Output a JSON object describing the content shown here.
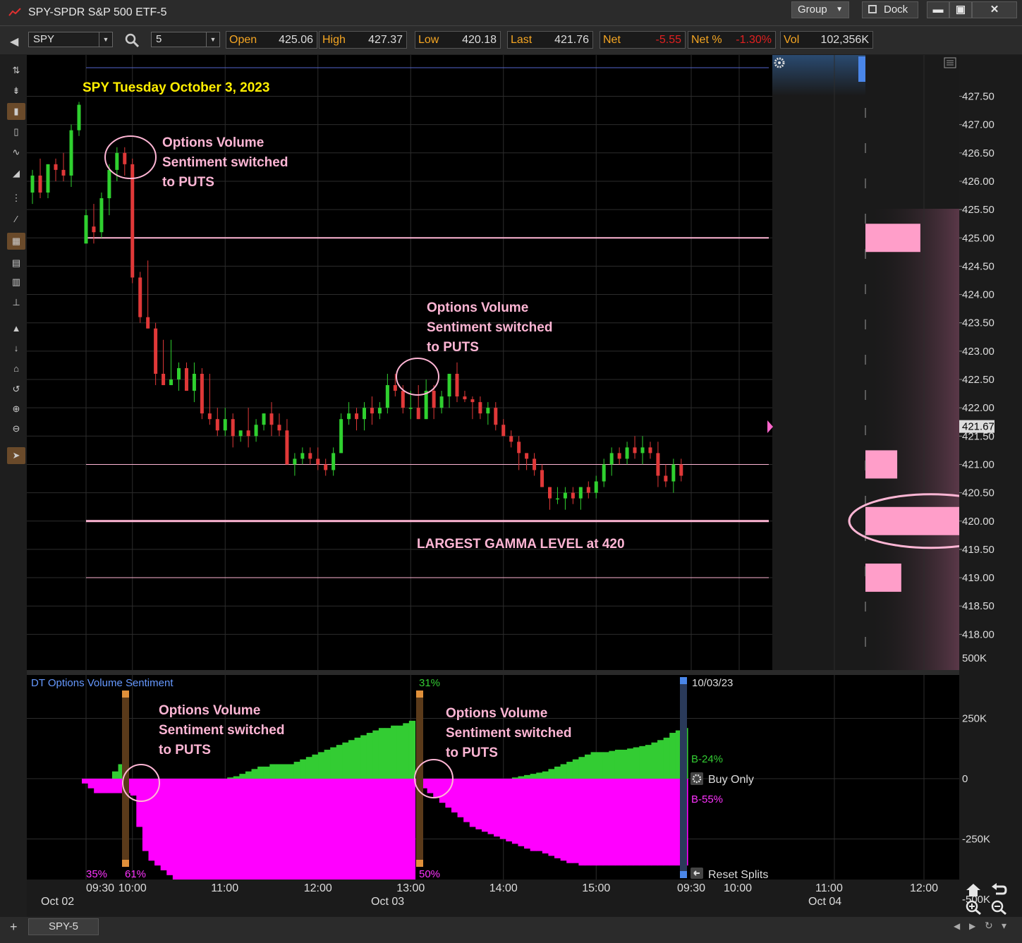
{
  "window": {
    "title": "SPY-SPDR S&P 500 ETF-5",
    "group_label": "Group",
    "dock_label": "Dock",
    "minimize_glyph": "▬",
    "maximize_glyph": "▣",
    "close_glyph": "✕"
  },
  "symbol_bar": {
    "symbol": "SPY",
    "interval": "5",
    "quotes": [
      {
        "label": "Open",
        "value": "425.06",
        "neg": false
      },
      {
        "label": "High",
        "value": "427.37",
        "neg": false
      },
      {
        "label": "Low",
        "value": "420.18",
        "neg": false
      },
      {
        "label": "Last",
        "value": "421.76",
        "neg": false
      },
      {
        "label": "Net",
        "value": "-5.55",
        "neg": true
      },
      {
        "label": "Net %",
        "value": "-1.30%",
        "neg": true
      },
      {
        "label": "Vol",
        "value": "102,356K",
        "neg": false
      }
    ]
  },
  "toolbar_icons": [
    "crosshair-icon",
    "cursor-data-icon",
    "candlestick-icon",
    "bar-chart-icon",
    "line-chart-icon",
    "area-chart-icon",
    "indicators-icon",
    "drawing-tool-icon",
    "grid-icon",
    "table-icon",
    "grid-small-icon",
    "horizontal-line-icon",
    "scroll-up-icon",
    "scroll-small-icon",
    "home-icon",
    "undo-icon",
    "zoom-in-icon",
    "zoom-out-icon",
    "select-arrow-icon"
  ],
  "chart_data": {
    "type": "candlestick",
    "title": "SPY Tuesday October 3, 2023",
    "interval_minutes": 5,
    "ylim": [
      417.6,
      427.9
    ],
    "yticks": [
      "427.50",
      "427.00",
      "426.50",
      "426.00",
      "425.50",
      "425.00",
      "424.50",
      "424.00",
      "423.50",
      "423.00",
      "422.50",
      "422.00",
      "421.50",
      "421.00",
      "420.50",
      "420.00",
      "419.50",
      "419.00",
      "418.50",
      "418.00"
    ],
    "last_price_label": "421.67",
    "x_start": "Oct 02 15:30",
    "x_end": "Oct 04 12:00",
    "time_labels": [
      "09:30",
      "10:00",
      "11:00",
      "12:00",
      "13:00",
      "14:00",
      "15:00",
      "09:30",
      "10:00",
      "11:00",
      "12:00"
    ],
    "date_labels": [
      "Oct 02",
      "Oct 03",
      "Oct 04"
    ],
    "candles_prev_day": [
      {
        "t": "Oct 02 15:30",
        "o": 425.8,
        "h": 426.2,
        "l": 425.6,
        "c": 426.1
      },
      {
        "t": "Oct 02 15:35",
        "o": 426.1,
        "h": 426.4,
        "l": 425.7,
        "c": 425.8
      },
      {
        "t": "Oct 02 15:40",
        "o": 425.8,
        "h": 426.3,
        "l": 425.7,
        "c": 426.3
      },
      {
        "t": "Oct 02 15:45",
        "o": 426.3,
        "h": 426.4,
        "l": 426.0,
        "c": 426.2
      },
      {
        "t": "Oct 02 15:50",
        "o": 426.2,
        "h": 426.5,
        "l": 426.0,
        "c": 426.1
      },
      {
        "t": "Oct 02 15:55",
        "o": 426.1,
        "h": 427.0,
        "l": 425.9,
        "c": 426.9
      },
      {
        "t": "Oct 02 16:00",
        "o": 426.9,
        "h": 427.4,
        "l": 426.8,
        "c": 427.35
      }
    ],
    "candles": [
      {
        "t": "09:30",
        "o": 424.9,
        "h": 425.5,
        "l": 424.9,
        "c": 425.4
      },
      {
        "t": "09:35",
        "o": 425.2,
        "h": 425.6,
        "l": 424.9,
        "c": 425.1
      },
      {
        "t": "09:40",
        "o": 425.1,
        "h": 425.8,
        "l": 425.0,
        "c": 425.7
      },
      {
        "t": "09:45",
        "o": 425.7,
        "h": 426.3,
        "l": 425.4,
        "c": 426.2
      },
      {
        "t": "09:50",
        "o": 426.2,
        "h": 426.6,
        "l": 426.0,
        "c": 426.5
      },
      {
        "t": "09:55",
        "o": 426.5,
        "h": 426.6,
        "l": 426.1,
        "c": 426.3
      },
      {
        "t": "10:00",
        "o": 426.3,
        "h": 426.4,
        "l": 424.2,
        "c": 424.3
      },
      {
        "t": "10:05",
        "o": 424.3,
        "h": 424.4,
        "l": 423.5,
        "c": 423.6
      },
      {
        "t": "10:10",
        "o": 423.6,
        "h": 424.6,
        "l": 423.4,
        "c": 423.4
      },
      {
        "t": "10:15",
        "o": 423.4,
        "h": 423.5,
        "l": 422.4,
        "c": 422.6
      },
      {
        "t": "10:20",
        "o": 422.6,
        "h": 423.2,
        "l": 422.4,
        "c": 422.4
      },
      {
        "t": "10:25",
        "o": 422.4,
        "h": 423.2,
        "l": 422.4,
        "c": 422.5
      },
      {
        "t": "10:30",
        "o": 422.5,
        "h": 422.8,
        "l": 422.3,
        "c": 422.7
      },
      {
        "t": "10:35",
        "o": 422.7,
        "h": 422.8,
        "l": 422.3,
        "c": 422.3
      },
      {
        "t": "10:40",
        "o": 422.3,
        "h": 422.8,
        "l": 422.1,
        "c": 422.6
      },
      {
        "t": "10:45",
        "o": 422.6,
        "h": 422.7,
        "l": 421.8,
        "c": 421.9
      },
      {
        "t": "10:50",
        "o": 421.9,
        "h": 422.6,
        "l": 421.7,
        "c": 421.8
      },
      {
        "t": "10:55",
        "o": 421.8,
        "h": 422.0,
        "l": 421.5,
        "c": 421.6
      },
      {
        "t": "11:00",
        "o": 421.6,
        "h": 422.0,
        "l": 421.5,
        "c": 421.8
      },
      {
        "t": "11:05",
        "o": 421.8,
        "h": 421.9,
        "l": 421.3,
        "c": 421.5
      },
      {
        "t": "11:10",
        "o": 421.5,
        "h": 421.6,
        "l": 421.4,
        "c": 421.6
      },
      {
        "t": "11:15",
        "o": 421.6,
        "h": 422.0,
        "l": 421.3,
        "c": 421.5
      },
      {
        "t": "11:20",
        "o": 421.5,
        "h": 421.8,
        "l": 421.4,
        "c": 421.7
      },
      {
        "t": "11:25",
        "o": 421.7,
        "h": 421.9,
        "l": 421.6,
        "c": 421.9
      },
      {
        "t": "11:30",
        "o": 421.9,
        "h": 422.1,
        "l": 421.5,
        "c": 421.7
      },
      {
        "t": "11:35",
        "o": 421.7,
        "h": 421.9,
        "l": 421.5,
        "c": 421.6
      },
      {
        "t": "11:40",
        "o": 421.6,
        "h": 421.8,
        "l": 421.0,
        "c": 421.0
      },
      {
        "t": "11:45",
        "o": 421.0,
        "h": 421.2,
        "l": 420.8,
        "c": 421.1
      },
      {
        "t": "11:50",
        "o": 421.1,
        "h": 421.3,
        "l": 421.0,
        "c": 421.2
      },
      {
        "t": "11:55",
        "o": 421.2,
        "h": 421.3,
        "l": 421.0,
        "c": 421.1
      },
      {
        "t": "12:00",
        "o": 421.1,
        "h": 421.3,
        "l": 420.9,
        "c": 421.0
      },
      {
        "t": "12:05",
        "o": 421.0,
        "h": 421.1,
        "l": 420.8,
        "c": 420.9
      },
      {
        "t": "12:10",
        "o": 420.9,
        "h": 421.3,
        "l": 420.8,
        "c": 421.2
      },
      {
        "t": "12:15",
        "o": 421.2,
        "h": 421.9,
        "l": 421.2,
        "c": 421.8
      },
      {
        "t": "12:20",
        "o": 421.8,
        "h": 422.1,
        "l": 421.7,
        "c": 421.9
      },
      {
        "t": "12:25",
        "o": 421.9,
        "h": 422.0,
        "l": 421.6,
        "c": 421.8
      },
      {
        "t": "12:30",
        "o": 421.8,
        "h": 422.1,
        "l": 421.6,
        "c": 422.0
      },
      {
        "t": "12:35",
        "o": 422.0,
        "h": 422.2,
        "l": 421.7,
        "c": 421.9
      },
      {
        "t": "12:40",
        "o": 421.9,
        "h": 422.1,
        "l": 421.8,
        "c": 422.0
      },
      {
        "t": "12:45",
        "o": 422.0,
        "h": 422.6,
        "l": 421.9,
        "c": 422.4
      },
      {
        "t": "12:50",
        "o": 422.4,
        "h": 422.6,
        "l": 422.2,
        "c": 422.3
      },
      {
        "t": "12:55",
        "o": 422.3,
        "h": 422.4,
        "l": 421.9,
        "c": 422.0
      },
      {
        "t": "13:00",
        "o": 422.0,
        "h": 422.3,
        "l": 421.8,
        "c": 422.0
      },
      {
        "t": "13:05",
        "o": 422.0,
        "h": 422.4,
        "l": 421.8,
        "c": 421.8
      },
      {
        "t": "13:10",
        "o": 421.8,
        "h": 422.5,
        "l": 421.8,
        "c": 422.3
      },
      {
        "t": "13:15",
        "o": 422.3,
        "h": 422.4,
        "l": 421.8,
        "c": 422.0
      },
      {
        "t": "13:20",
        "o": 422.0,
        "h": 422.3,
        "l": 421.9,
        "c": 422.2
      },
      {
        "t": "13:25",
        "o": 422.2,
        "h": 422.6,
        "l": 422.0,
        "c": 422.6
      },
      {
        "t": "13:30",
        "o": 422.6,
        "h": 422.8,
        "l": 422.1,
        "c": 422.2
      },
      {
        "t": "13:35",
        "o": 422.2,
        "h": 422.3,
        "l": 422.1,
        "c": 422.15
      },
      {
        "t": "13:40",
        "o": 422.15,
        "h": 422.2,
        "l": 421.8,
        "c": 422.1
      },
      {
        "t": "13:45",
        "o": 422.1,
        "h": 422.2,
        "l": 421.8,
        "c": 421.9
      },
      {
        "t": "13:50",
        "o": 421.9,
        "h": 422.1,
        "l": 421.7,
        "c": 422.0
      },
      {
        "t": "13:55",
        "o": 422.0,
        "h": 422.1,
        "l": 421.6,
        "c": 421.7
      },
      {
        "t": "14:00",
        "o": 421.7,
        "h": 421.8,
        "l": 421.5,
        "c": 421.5
      },
      {
        "t": "14:05",
        "o": 421.5,
        "h": 421.6,
        "l": 421.3,
        "c": 421.4
      },
      {
        "t": "14:10",
        "o": 421.4,
        "h": 421.5,
        "l": 420.9,
        "c": 421.2
      },
      {
        "t": "14:15",
        "o": 421.2,
        "h": 421.2,
        "l": 420.9,
        "c": 421.1
      },
      {
        "t": "14:20",
        "o": 421.1,
        "h": 421.2,
        "l": 420.8,
        "c": 420.9
      },
      {
        "t": "14:25",
        "o": 420.9,
        "h": 421.0,
        "l": 420.6,
        "c": 420.6
      },
      {
        "t": "14:30",
        "o": 420.6,
        "h": 420.6,
        "l": 420.2,
        "c": 420.4
      },
      {
        "t": "14:35",
        "o": 420.4,
        "h": 420.6,
        "l": 420.3,
        "c": 420.4
      },
      {
        "t": "14:40",
        "o": 420.4,
        "h": 420.6,
        "l": 420.2,
        "c": 420.5
      },
      {
        "t": "14:45",
        "o": 420.5,
        "h": 420.6,
        "l": 420.3,
        "c": 420.4
      },
      {
        "t": "14:50",
        "o": 420.4,
        "h": 420.6,
        "l": 420.2,
        "c": 420.6
      },
      {
        "t": "14:55",
        "o": 420.6,
        "h": 420.7,
        "l": 420.4,
        "c": 420.5
      },
      {
        "t": "15:00",
        "o": 420.5,
        "h": 420.8,
        "l": 420.4,
        "c": 420.7
      },
      {
        "t": "15:05",
        "o": 420.7,
        "h": 421.1,
        "l": 420.6,
        "c": 421.0
      },
      {
        "t": "15:10",
        "o": 421.0,
        "h": 421.3,
        "l": 420.8,
        "c": 421.2
      },
      {
        "t": "15:15",
        "o": 421.2,
        "h": 421.3,
        "l": 421.0,
        "c": 421.1
      },
      {
        "t": "15:20",
        "o": 421.1,
        "h": 421.4,
        "l": 421.0,
        "c": 421.3
      },
      {
        "t": "15:25",
        "o": 421.3,
        "h": 421.5,
        "l": 421.1,
        "c": 421.2
      },
      {
        "t": "15:30",
        "o": 421.2,
        "h": 421.5,
        "l": 421.0,
        "c": 421.3
      },
      {
        "t": "15:35",
        "o": 421.3,
        "h": 421.4,
        "l": 421.1,
        "c": 421.2
      },
      {
        "t": "15:40",
        "o": 421.2,
        "h": 421.4,
        "l": 420.6,
        "c": 420.8
      },
      {
        "t": "15:45",
        "o": 420.8,
        "h": 421.0,
        "l": 420.6,
        "c": 420.7
      },
      {
        "t": "15:50",
        "o": 420.7,
        "h": 421.1,
        "l": 420.5,
        "c": 421.0
      },
      {
        "t": "15:55",
        "o": 421.0,
        "h": 421.1,
        "l": 420.7,
        "c": 420.8
      }
    ],
    "gamma_lines": [
      425.0,
      421.0,
      420.0,
      419.0
    ],
    "gamma_bars": [
      {
        "price": 425.0,
        "strength": 0.95
      },
      {
        "price": 421.0,
        "strength": 0.55
      },
      {
        "price": 420.0,
        "strength": 1.65
      },
      {
        "price": 419.0,
        "strength": 0.62
      }
    ],
    "annotations": [
      {
        "id": "ann1",
        "lines": [
          "Options Volume",
          "Sentiment switched",
          "to PUTS"
        ]
      },
      {
        "id": "ann2",
        "lines": [
          "Options Volume",
          "Sentiment switched",
          "to PUTS"
        ]
      },
      {
        "id": "gamma",
        "lines": [
          "LARGEST GAMMA LEVEL at 420"
        ]
      }
    ]
  },
  "indicator": {
    "title": "DT Options Volume Sentiment",
    "date_label": "10/03/23",
    "yticks": [
      "500K",
      "250K",
      "0",
      "-250K",
      "-500K"
    ],
    "ylim": [
      -750,
      750
    ],
    "calls_label": "B-24%",
    "puts_label": "B-55%",
    "buy_only_label": "Buy Only",
    "reset_label": "Reset Splits",
    "pct_labels": [
      {
        "text": "35%",
        "color": "#ff33ff"
      },
      {
        "text": "61%",
        "color": "#ff33ff"
      },
      {
        "text": "31%",
        "color": "#33cc33"
      },
      {
        "text": "50%",
        "color": "#ff33ff"
      }
    ],
    "annotations": [
      {
        "lines": [
          "Options Volume",
          "Sentiment switched",
          "to PUTS"
        ]
      },
      {
        "lines": [
          "Options Volume",
          "Sentiment switched",
          "to PUTS"
        ]
      }
    ],
    "calls_series_k": [
      0,
      0,
      0,
      0,
      0,
      30,
      60,
      0,
      0,
      0,
      0,
      0,
      0,
      0,
      0,
      0,
      0,
      0,
      0,
      0,
      0,
      0,
      0,
      0,
      5,
      10,
      20,
      30,
      40,
      50,
      50,
      60,
      60,
      60,
      60,
      70,
      80,
      90,
      100,
      110,
      120,
      130,
      140,
      150,
      160,
      170,
      180,
      190,
      200,
      210,
      210,
      220,
      220,
      230,
      240,
      0,
      0,
      0,
      0,
      0,
      0,
      0,
      0,
      0,
      0,
      0,
      0,
      0,
      0,
      0,
      0,
      5,
      10,
      15,
      20,
      25,
      30,
      40,
      50,
      60,
      70,
      80,
      90,
      100,
      110,
      110,
      110,
      115,
      120,
      120,
      125,
      130,
      135,
      140,
      150,
      160,
      170,
      190,
      200,
      210
    ],
    "puts_series_k": [
      -20,
      -40,
      -60,
      -60,
      -60,
      -60,
      -60,
      -60,
      -70,
      -200,
      -300,
      -340,
      -360,
      -380,
      -400,
      -420,
      -440,
      -460,
      -480,
      -500,
      -520,
      -540,
      -560,
      -580,
      -600,
      -620,
      -640,
      -650,
      -660,
      -680,
      -700,
      -710,
      -720,
      -730,
      -740,
      -750,
      -750,
      -750,
      -750,
      -750,
      -750,
      -750,
      -750,
      -750,
      -750,
      -750,
      -750,
      -750,
      -750,
      -750,
      -750,
      -750,
      -750,
      -750,
      -750,
      -20,
      -40,
      -60,
      -80,
      -100,
      -120,
      -140,
      -160,
      -180,
      -200,
      -210,
      -220,
      -230,
      -240,
      -250,
      -260,
      -270,
      -280,
      -290,
      -300,
      -300,
      -310,
      -320,
      -330,
      -340,
      -350,
      -350,
      -360,
      -360,
      -360,
      -360,
      -360,
      -360,
      -360,
      -360,
      -360,
      -360,
      -360,
      -360,
      -360,
      -360,
      -360,
      -360,
      -360,
      -360
    ]
  },
  "tabs": {
    "active_tab": "SPY-5",
    "add_glyph": "+"
  }
}
